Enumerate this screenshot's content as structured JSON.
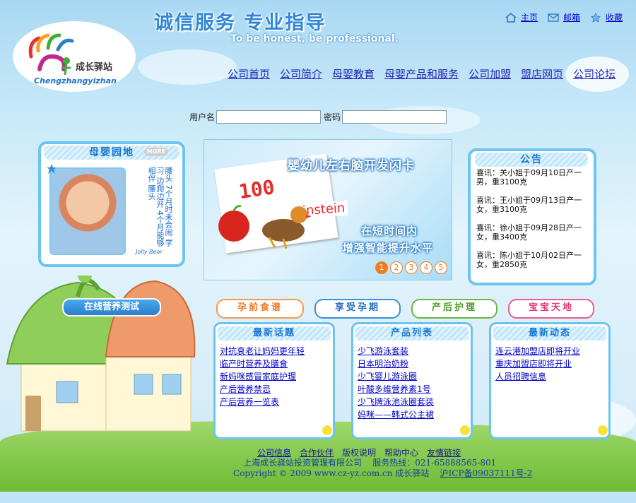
{
  "header": {
    "slogan_cn": "诚信服务  专业指导",
    "slogan_en": "To be honest, be professional.",
    "top_links": [
      {
        "label": "主页",
        "icon": "home-icon"
      },
      {
        "label": "邮箱",
        "icon": "mail-icon"
      },
      {
        "label": "收藏",
        "icon": "star-icon"
      }
    ]
  },
  "logo": {
    "pinyin": "Chengzhangyizhan",
    "name": "成长驿站"
  },
  "nav": [
    "公司首页",
    "公司简介",
    "母婴教育",
    "母婴产品和服务",
    "公司加盟",
    "盟店网页",
    "公司论坛"
  ],
  "login": {
    "username_label": "用户名",
    "password_label": "密码",
    "username_value": "",
    "password_value": ""
  },
  "baby_garden": {
    "title": "母婴园地",
    "more": "MORE",
    "caption_lines": [
      "腰头 7个月时未会闹",
      "学习 边爬边开",
      "4个月能够相伴",
      "腰头"
    ],
    "signature": "Jolly Bear"
  },
  "banner": {
    "title": "婴幼儿左右脑开发闪卡",
    "line1": "在短时间内",
    "line2": "增强智能提升水平",
    "card_number": "100",
    "card_word": "instein",
    "pages": [
      "1",
      "2",
      "3",
      "4",
      "5"
    ],
    "active_page": "1"
  },
  "announcement": {
    "title": "公告",
    "items": [
      "喜讯：关小姐于09月10日产一男，重3100克",
      "喜讯：王小姐于09月13日产一女，重3100克",
      "喜讯：徐小姐于09月28日产一女，重3400克",
      "喜讯：陈小姐于10月02日产一女，重2850克"
    ]
  },
  "nutrition_test": {
    "label": "在线营养测试"
  },
  "categories": [
    {
      "label": "孕前食谱",
      "color": "#f29a4a"
    },
    {
      "label": "享受孕期",
      "color": "#3a8fd8"
    },
    {
      "label": "产后护理",
      "color": "#6ab83c"
    },
    {
      "label": "宝宝天地",
      "color": "#e85a8c"
    }
  ],
  "lists": [
    {
      "title": "最新话题",
      "items": [
        "对抗衰老让妈妈更年轻",
        "临产时营养及膳食",
        "新妈咪感冒家庭护理",
        "产后营养禁忌",
        "产后营养一览表"
      ]
    },
    {
      "title": "产品列表",
      "items": [
        "少飞游泳套装",
        "日本明治奶粉",
        "少飞婴儿游泳圈",
        "叶酸多维营养素1号",
        "少飞牌泳池泳圈套装",
        "妈咪——韩式公主裙"
      ]
    },
    {
      "title": "最新动态",
      "items": [
        "连云港加盟店即将开业",
        "重庆加盟店即将开业",
        "人员招聘信息"
      ]
    }
  ],
  "footer": {
    "links": [
      "公司信息",
      "合作伙伴",
      "版权说明",
      "帮助中心",
      "友情链接"
    ],
    "company": "上海成长驿站投资管理有限公司",
    "hotline": "服务热线：021-65888565-801",
    "copyright": "Copyright © 2009 www.cz-yz.com.cn 成长驿站",
    "icp": "沪ICP备09037111号-2"
  }
}
